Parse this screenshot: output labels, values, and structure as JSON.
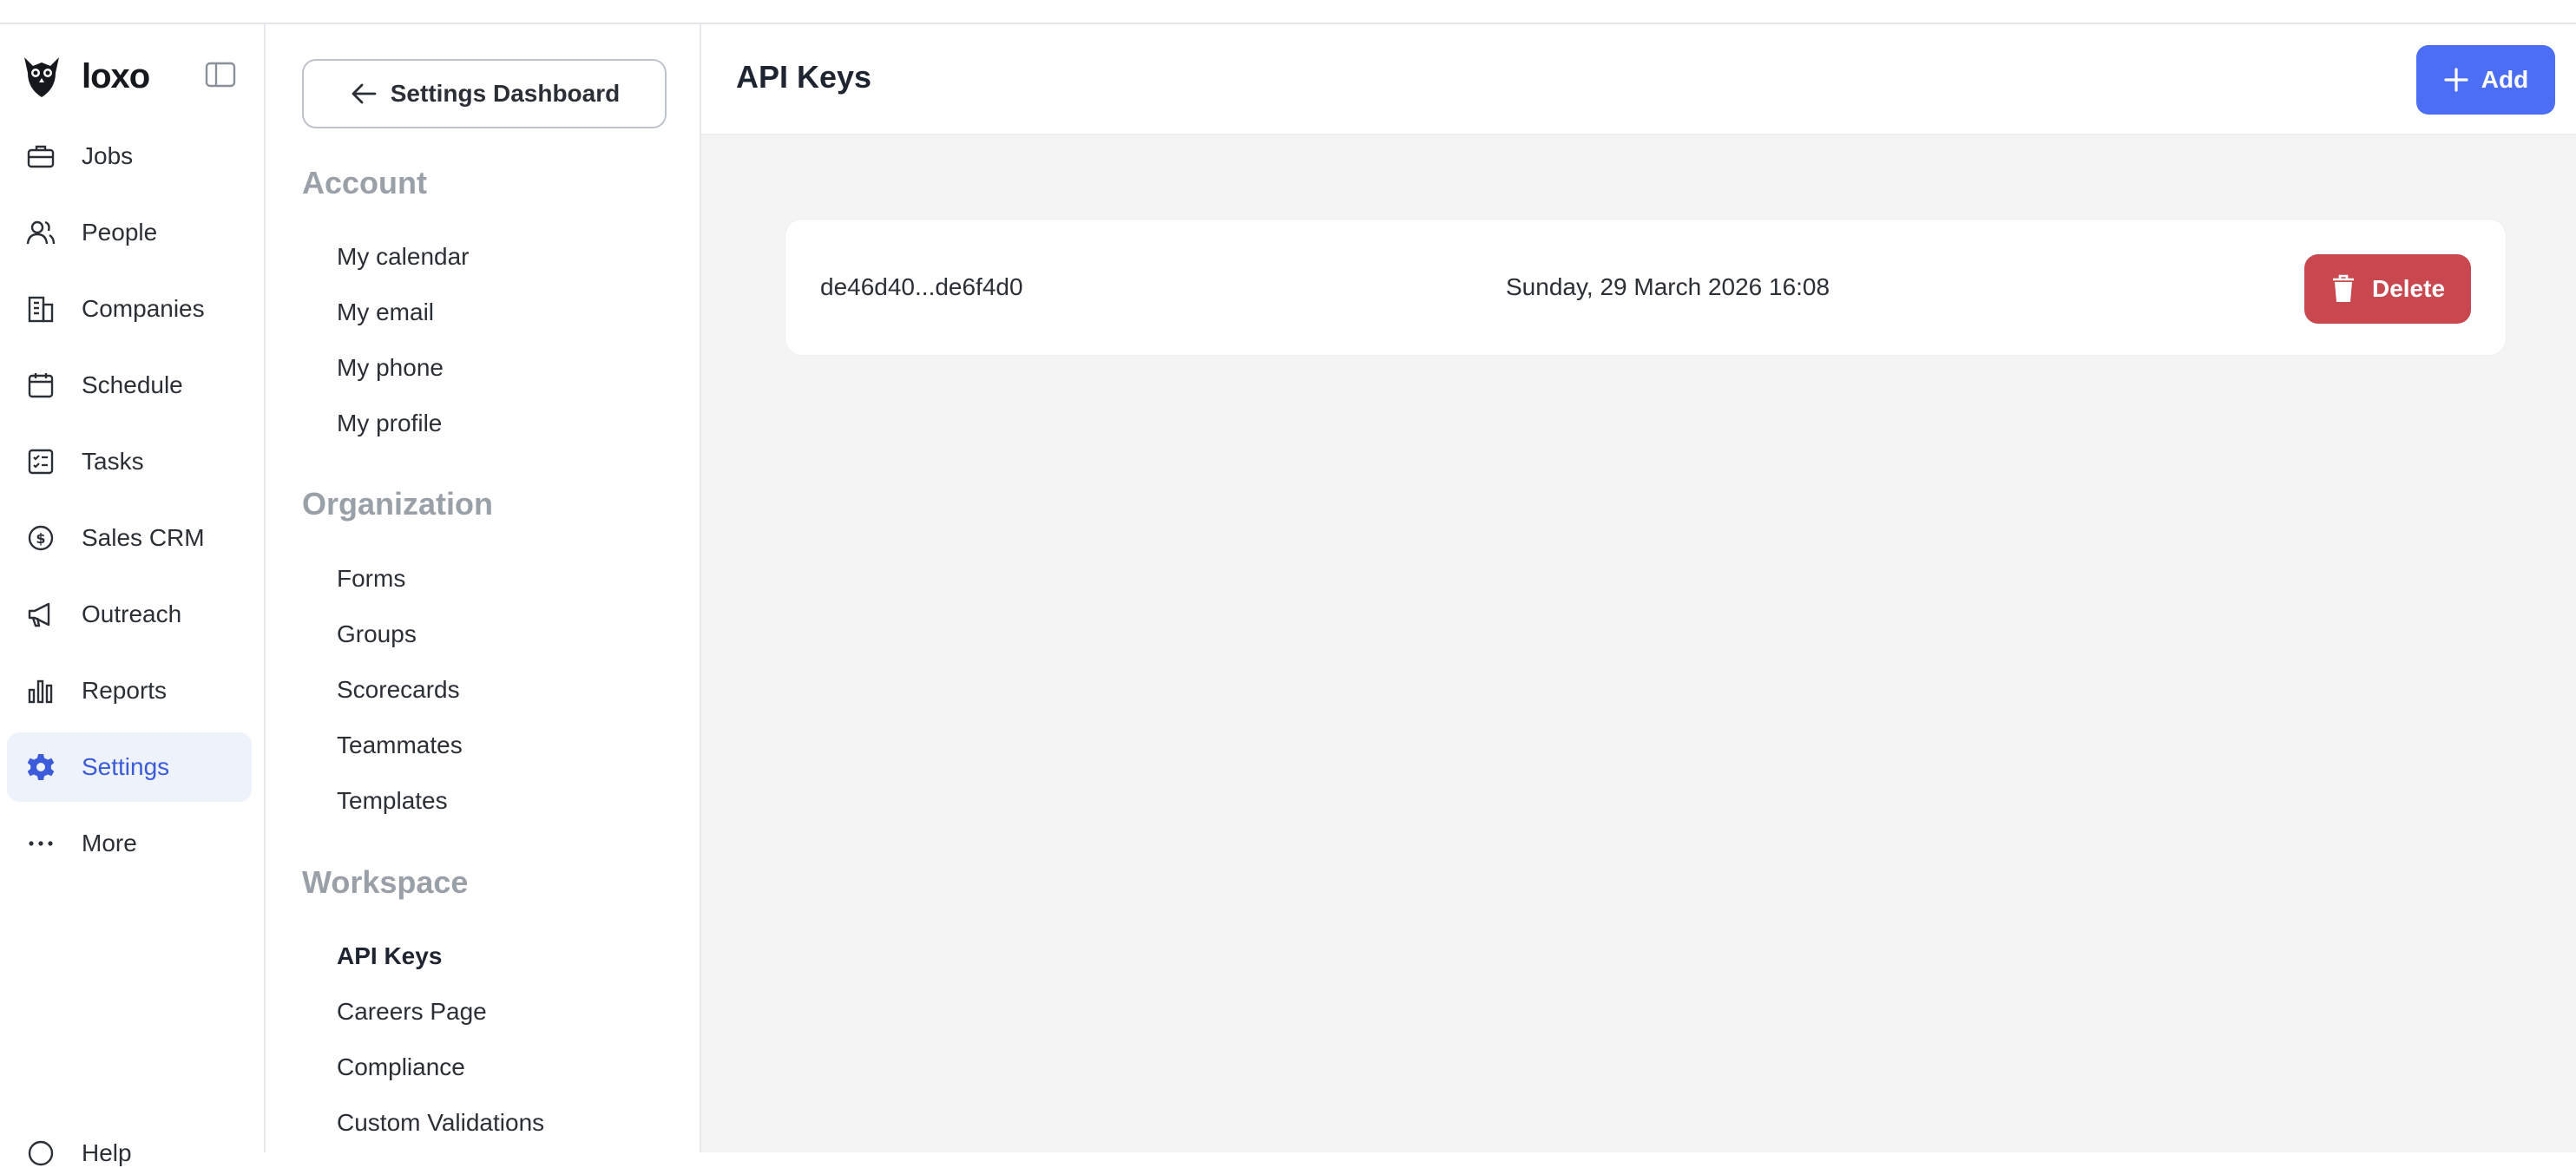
{
  "app": {
    "brand": "loxo"
  },
  "nav": {
    "items": [
      {
        "label": "Jobs",
        "icon": "briefcase-icon"
      },
      {
        "label": "People",
        "icon": "people-icon"
      },
      {
        "label": "Companies",
        "icon": "building-icon"
      },
      {
        "label": "Schedule",
        "icon": "calendar-icon"
      },
      {
        "label": "Tasks",
        "icon": "checklist-icon"
      },
      {
        "label": "Sales CRM",
        "icon": "dollar-circle-icon"
      },
      {
        "label": "Outreach",
        "icon": "megaphone-icon"
      },
      {
        "label": "Reports",
        "icon": "bar-chart-icon"
      },
      {
        "label": "Settings",
        "icon": "gear-icon",
        "active": true
      },
      {
        "label": "More",
        "icon": "ellipsis-icon"
      }
    ],
    "help_label": "Help"
  },
  "settings_nav": {
    "back_label": "Settings Dashboard",
    "sections": [
      {
        "title": "Account",
        "links": [
          "My calendar",
          "My email",
          "My phone",
          "My profile"
        ]
      },
      {
        "title": "Organization",
        "links": [
          "Forms",
          "Groups",
          "Scorecards",
          "Teammates",
          "Templates"
        ]
      },
      {
        "title": "Workspace",
        "links": [
          "API Keys",
          "Careers Page",
          "Compliance",
          "Custom Validations"
        ]
      }
    ],
    "current": "API Keys"
  },
  "header": {
    "title": "API Keys",
    "add_label": "Add"
  },
  "api_keys": [
    {
      "key": "de46d40...de6f4d0",
      "created": "Sunday, 29 March 2026 16:08",
      "delete_label": "Delete"
    }
  ],
  "colors": {
    "accent": "#4c6ef5",
    "danger": "#c9474f",
    "active_nav": "#3b5bdb"
  }
}
